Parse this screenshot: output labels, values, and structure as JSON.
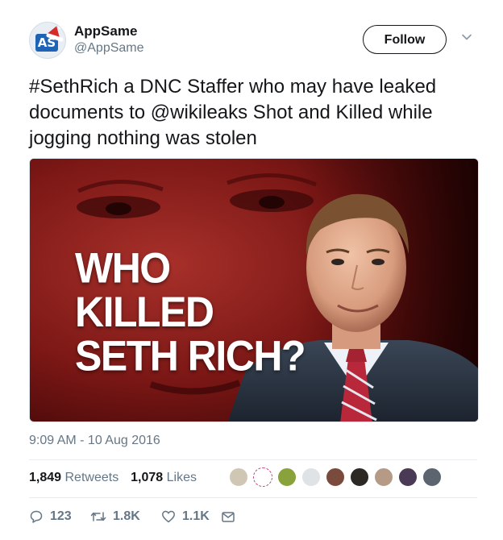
{
  "account": {
    "name": "AppSame",
    "handle": "@AppSame",
    "avatar_letters": "AS"
  },
  "follow_label": "Follow",
  "tweet_text": "#SethRich a DNC Staffer who may have leaked documents to @wikileaks Shot and Killed while jogging nothing was stolen",
  "media": {
    "headline_line1": "WHO KILLED",
    "headline_line2": "SETH RICH?"
  },
  "timestamp": "9:09 AM - 10 Aug 2016",
  "stats": {
    "retweets_count": "1,849",
    "retweets_label": "Retweets",
    "likes_count": "1,078",
    "likes_label": "Likes"
  },
  "actions": {
    "replies": "123",
    "retweets": "1.8K",
    "likes": "1.1K"
  },
  "colors": {
    "text": "#14171a",
    "secondary": "#657786",
    "divider": "#e6ecf0"
  },
  "icons": [
    "chevron-down-icon",
    "reply-icon",
    "retweet-icon",
    "like-icon",
    "message-icon"
  ]
}
